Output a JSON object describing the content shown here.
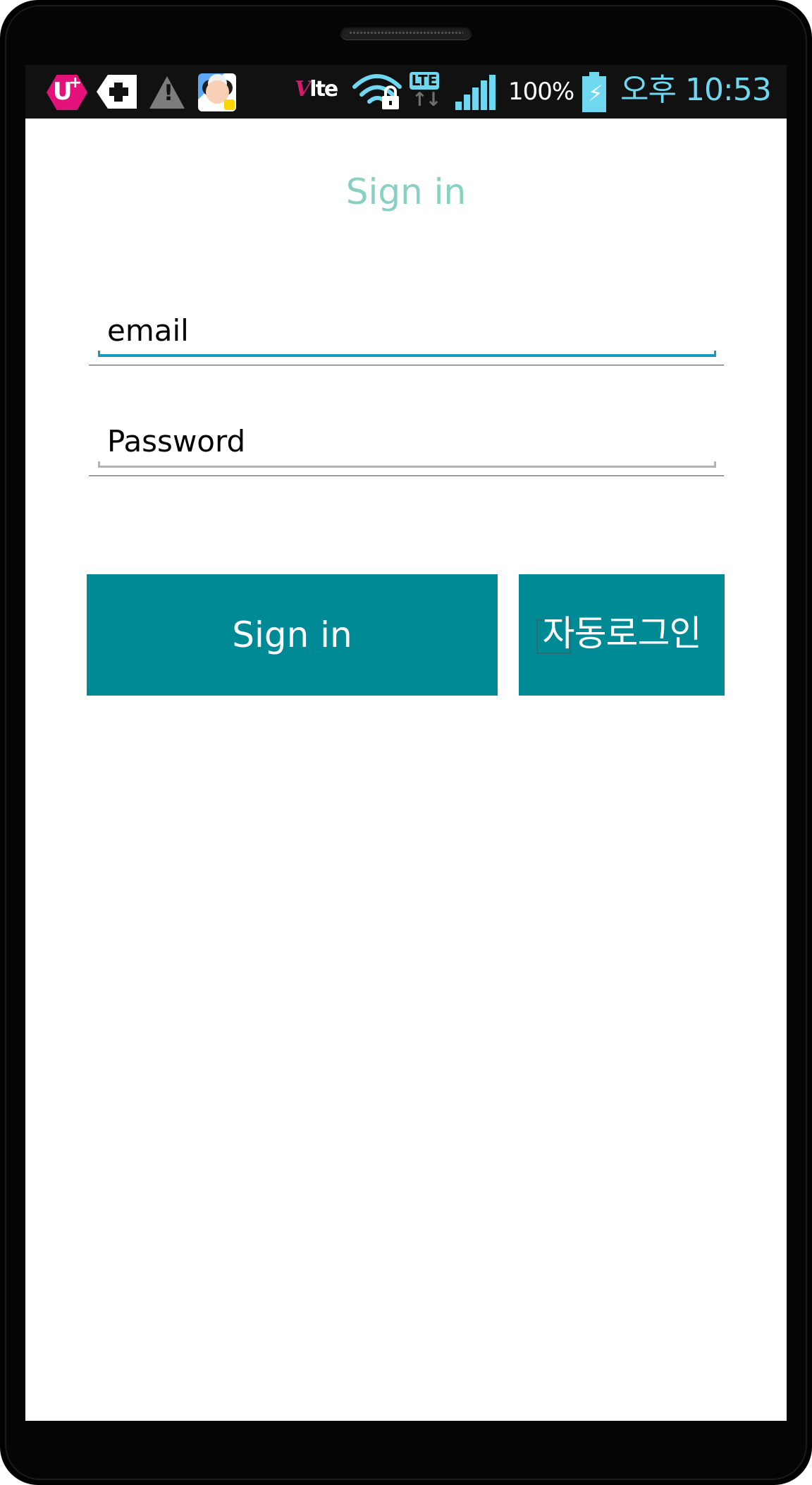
{
  "status_bar": {
    "carrier_icon": "uplus-icon",
    "tag_icon": "tag-plus-icon",
    "warning_icon": "warning-icon",
    "app_icon": "app-character-icon",
    "volte_v": "V",
    "volte_lte": "lte",
    "wifi_icon": "wifi-lock-icon",
    "lte_label": "LTE",
    "data_arrows": "↑↓",
    "signal_level": 5,
    "battery_percent_text": "100%",
    "battery_icon": "charging-battery-icon",
    "clock": "오후 10:53",
    "accent_color": "#70d7f1"
  },
  "app": {
    "title": "Sign in",
    "title_color": "#88d1c2"
  },
  "form": {
    "email": {
      "value": "",
      "placeholder": "email",
      "active": true,
      "accent_color": "#1998c6"
    },
    "password": {
      "value": "",
      "placeholder": "Password",
      "active": false,
      "accent_color": "#b3b3b3"
    }
  },
  "buttons": {
    "sign_in": "Sign in",
    "auto_login": "자동로그인",
    "background_color": "#008a96",
    "text_color": "#ffffff"
  }
}
